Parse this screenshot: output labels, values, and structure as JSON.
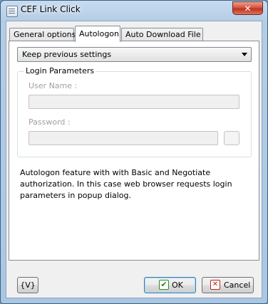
{
  "window": {
    "title": "CEF Link Click",
    "close_glyph": "✕"
  },
  "tabs": [
    {
      "label": "General options",
      "active": false
    },
    {
      "label": "Autologon",
      "active": true
    },
    {
      "label": "Auto Download File",
      "active": false
    }
  ],
  "autologon": {
    "mode_selected": "Keep previous settings",
    "group_title": "Login Parameters",
    "username_label": "User Name :",
    "username_value": "",
    "password_label": "Password :",
    "password_value": "",
    "description": "Autologon feature with with Basic and Negotiate authorization. In this case web browser requests login parameters in popup dialog."
  },
  "footer": {
    "variables_label": "{V}",
    "ok_label": "OK",
    "ok_icon": "✔",
    "cancel_label": "Cancel",
    "cancel_icon": "✕"
  }
}
